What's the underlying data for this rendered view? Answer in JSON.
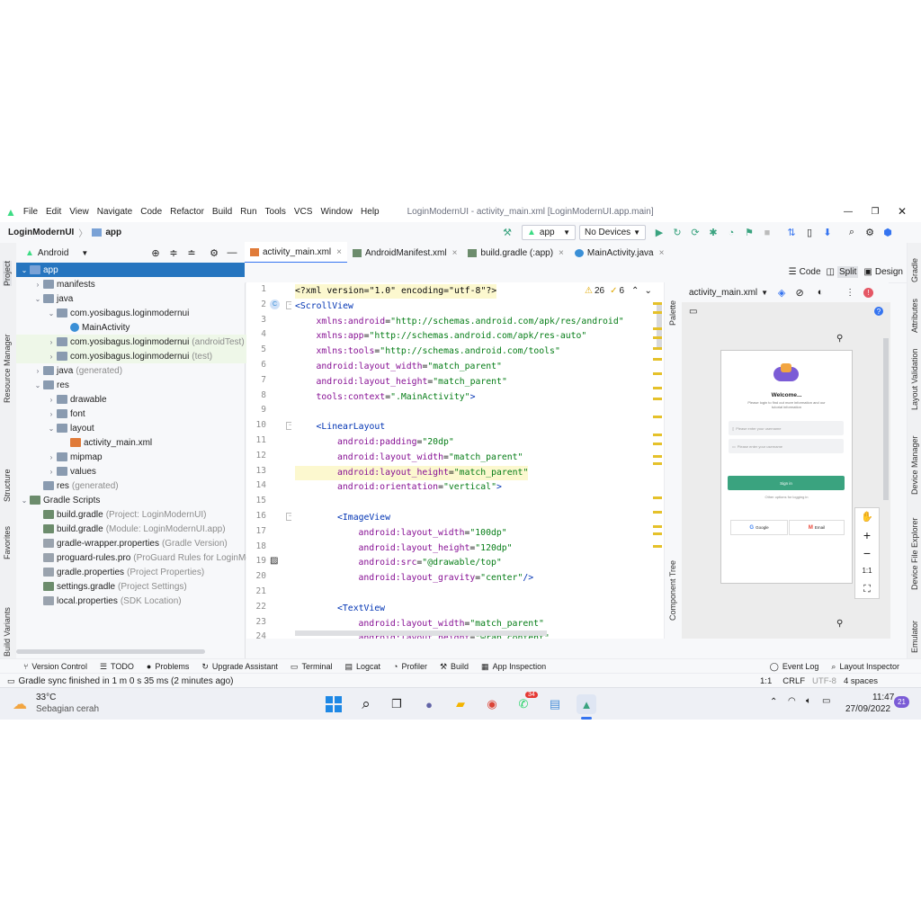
{
  "window": {
    "title": "LoginModernUI - activity_main.xml [LoginModernUI.app.main]"
  },
  "menu": [
    "File",
    "Edit",
    "View",
    "Navigate",
    "Code",
    "Refactor",
    "Build",
    "Run",
    "Tools",
    "VCS",
    "Window",
    "Help"
  ],
  "breadcrumb": {
    "project": "LoginModernUI",
    "module": "app"
  },
  "toolbar": {
    "run_config": "app",
    "device": "No Devices"
  },
  "left_strip": [
    "Project",
    "Resource Manager",
    "Structure",
    "Favorites",
    "Build Variants"
  ],
  "right_strip": [
    "Gradle",
    "Attributes",
    "Layout Validation",
    "Device Manager",
    "Device File Explorer",
    "Emulator"
  ],
  "project_panel": {
    "view": "Android",
    "tree": [
      {
        "label": "app",
        "hint": "",
        "level": 0,
        "open": true,
        "kind": "module",
        "selected": true
      },
      {
        "label": "manifests",
        "hint": "",
        "level": 1,
        "open": false,
        "kind": "folder"
      },
      {
        "label": "java",
        "hint": "",
        "level": 1,
        "open": true,
        "kind": "folder"
      },
      {
        "label": "com.yosibagus.loginmodernui",
        "hint": "",
        "level": 2,
        "open": true,
        "kind": "package"
      },
      {
        "label": "MainActivity",
        "hint": "",
        "level": 3,
        "leaf": true,
        "kind": "class"
      },
      {
        "label": "com.yosibagus.loginmodernui",
        "hint": "(androidTest)",
        "level": 2,
        "open": false,
        "kind": "package",
        "green": true
      },
      {
        "label": "com.yosibagus.loginmodernui",
        "hint": "(test)",
        "level": 2,
        "open": false,
        "kind": "package",
        "green": true
      },
      {
        "label": "java",
        "hint": "(generated)",
        "level": 1,
        "open": false,
        "kind": "folder"
      },
      {
        "label": "res",
        "hint": "",
        "level": 1,
        "open": true,
        "kind": "folder"
      },
      {
        "label": "drawable",
        "hint": "",
        "level": 2,
        "open": false,
        "kind": "folder"
      },
      {
        "label": "font",
        "hint": "",
        "level": 2,
        "open": false,
        "kind": "folder"
      },
      {
        "label": "layout",
        "hint": "",
        "level": 2,
        "open": true,
        "kind": "folder"
      },
      {
        "label": "activity_main.xml",
        "hint": "",
        "level": 3,
        "leaf": true,
        "kind": "xml"
      },
      {
        "label": "mipmap",
        "hint": "",
        "level": 2,
        "open": false,
        "kind": "folder"
      },
      {
        "label": "values",
        "hint": "",
        "level": 2,
        "open": false,
        "kind": "folder"
      },
      {
        "label": "res",
        "hint": "(generated)",
        "level": 1,
        "leaf": true,
        "kind": "folder"
      },
      {
        "label": "Gradle Scripts",
        "hint": "",
        "level": 0,
        "open": true,
        "kind": "gradle"
      },
      {
        "label": "build.gradle",
        "hint": "(Project: LoginModernUI)",
        "level": 1,
        "leaf": true,
        "kind": "gradle"
      },
      {
        "label": "build.gradle",
        "hint": "(Module: LoginModernUI.app)",
        "level": 1,
        "leaf": true,
        "kind": "gradle"
      },
      {
        "label": "gradle-wrapper.properties",
        "hint": "(Gradle Version)",
        "level": 1,
        "leaf": true,
        "kind": "props"
      },
      {
        "label": "proguard-rules.pro",
        "hint": "(ProGuard Rules for LoginMo",
        "level": 1,
        "leaf": true,
        "kind": "props"
      },
      {
        "label": "gradle.properties",
        "hint": "(Project Properties)",
        "level": 1,
        "leaf": true,
        "kind": "props"
      },
      {
        "label": "settings.gradle",
        "hint": "(Project Settings)",
        "level": 1,
        "leaf": true,
        "kind": "gradle"
      },
      {
        "label": "local.properties",
        "hint": "(SDK Location)",
        "level": 1,
        "leaf": true,
        "kind": "props"
      }
    ]
  },
  "editor_tabs": [
    {
      "label": "activity_main.xml",
      "active": true,
      "icon": "xml-icon"
    },
    {
      "label": "AndroidManifest.xml",
      "active": false,
      "icon": "manifest-icon"
    },
    {
      "label": "build.gradle (:app)",
      "active": false,
      "icon": "gradle-icon"
    },
    {
      "label": "MainActivity.java",
      "active": false,
      "icon": "class-icon"
    }
  ],
  "view_modes": [
    "Code",
    "Split",
    "Design"
  ],
  "inspections": {
    "warnings": "26",
    "weak": "6"
  },
  "code_lines": [
    {
      "n": "1",
      "indent": 0,
      "parts": [
        [
          "plain",
          "<?xml version=\"1.0\" encoding=\"utf-8\"?>"
        ]
      ],
      "hl": true
    },
    {
      "n": "2",
      "indent": 0,
      "parts": [
        [
          "tag",
          "<ScrollView"
        ]
      ]
    },
    {
      "n": "3",
      "indent": 1,
      "parts": [
        [
          "attr",
          "xmlns:android"
        ],
        [
          "plain",
          "="
        ],
        [
          "val",
          "\"http://schemas.android.com/apk/res/android\""
        ]
      ]
    },
    {
      "n": "4",
      "indent": 1,
      "parts": [
        [
          "attr",
          "xmlns:app"
        ],
        [
          "plain",
          "="
        ],
        [
          "val",
          "\"http://schemas.android.com/apk/res-auto\""
        ]
      ]
    },
    {
      "n": "5",
      "indent": 1,
      "parts": [
        [
          "attr",
          "xmlns:tools"
        ],
        [
          "plain",
          "="
        ],
        [
          "val",
          "\"http://schemas.android.com/tools\""
        ]
      ]
    },
    {
      "n": "6",
      "indent": 1,
      "parts": [
        [
          "attr",
          "android:layout_width"
        ],
        [
          "plain",
          "="
        ],
        [
          "val",
          "\"match_parent\""
        ]
      ]
    },
    {
      "n": "7",
      "indent": 1,
      "parts": [
        [
          "attr",
          "android:layout_height"
        ],
        [
          "plain",
          "="
        ],
        [
          "val",
          "\"match_parent\""
        ]
      ]
    },
    {
      "n": "8",
      "indent": 1,
      "parts": [
        [
          "attr",
          "tools:context"
        ],
        [
          "plain",
          "="
        ],
        [
          "val",
          "\".MainActivity\""
        ],
        [
          "tag",
          ">"
        ]
      ]
    },
    {
      "n": "9",
      "indent": 0,
      "parts": []
    },
    {
      "n": "10",
      "indent": 1,
      "parts": [
        [
          "tag",
          "<LinearLayout"
        ]
      ]
    },
    {
      "n": "11",
      "indent": 2,
      "parts": [
        [
          "attr",
          "android:padding"
        ],
        [
          "plain",
          "="
        ],
        [
          "val",
          "\"20dp\""
        ]
      ]
    },
    {
      "n": "12",
      "indent": 2,
      "parts": [
        [
          "attr",
          "android:layout_width"
        ],
        [
          "plain",
          "="
        ],
        [
          "val",
          "\"match_parent\""
        ]
      ]
    },
    {
      "n": "13",
      "indent": 2,
      "parts": [
        [
          "attr",
          "android:layout_height"
        ],
        [
          "plain",
          "="
        ],
        [
          "val",
          "\"match_parent\""
        ]
      ],
      "hl": true
    },
    {
      "n": "14",
      "indent": 2,
      "parts": [
        [
          "attr",
          "android:orientation"
        ],
        [
          "plain",
          "="
        ],
        [
          "val",
          "\"vertical\""
        ],
        [
          "tag",
          ">"
        ]
      ]
    },
    {
      "n": "15",
      "indent": 0,
      "parts": []
    },
    {
      "n": "16",
      "indent": 2,
      "parts": [
        [
          "tag",
          "<ImageView"
        ]
      ]
    },
    {
      "n": "17",
      "indent": 3,
      "parts": [
        [
          "attr",
          "android:layout_width"
        ],
        [
          "plain",
          "="
        ],
        [
          "val",
          "\"100dp\""
        ]
      ]
    },
    {
      "n": "18",
      "indent": 3,
      "parts": [
        [
          "attr",
          "android:layout_height"
        ],
        [
          "plain",
          "="
        ],
        [
          "val",
          "\"120dp\""
        ]
      ]
    },
    {
      "n": "19",
      "indent": 3,
      "parts": [
        [
          "attr",
          "android:src"
        ],
        [
          "plain",
          "="
        ],
        [
          "val",
          "\"@drawable/top\""
        ]
      ]
    },
    {
      "n": "20",
      "indent": 3,
      "parts": [
        [
          "attr",
          "android:layout_gravity"
        ],
        [
          "plain",
          "="
        ],
        [
          "val",
          "\"center\""
        ],
        [
          "tag",
          "/>"
        ]
      ]
    },
    {
      "n": "21",
      "indent": 0,
      "parts": []
    },
    {
      "n": "22",
      "indent": 2,
      "parts": [
        [
          "tag",
          "<TextView"
        ]
      ]
    },
    {
      "n": "23",
      "indent": 3,
      "parts": [
        [
          "attr",
          "android:layout_width"
        ],
        [
          "plain",
          "="
        ],
        [
          "val",
          "\"match_parent\""
        ]
      ]
    },
    {
      "n": "24",
      "indent": 3,
      "parts": [
        [
          "attr",
          "android:layout_height"
        ],
        [
          "plain",
          "="
        ],
        [
          "val",
          "\"wrap_content\""
        ]
      ]
    }
  ],
  "preview": {
    "file": "activity_main.xml",
    "palette": "Palette",
    "component_tree": "Component Tree",
    "zoom_reset": "1:1",
    "app": {
      "welcome": "Welcome...",
      "subtitle": "Please login to find out more information and our tutorial information",
      "username_hint": "Please enter your username",
      "password_hint": "Please enter your username",
      "signin": "Sign in",
      "other": "Other options for logging in",
      "google": "Google",
      "email": "Email"
    }
  },
  "toolwindows": [
    "Version Control",
    "TODO",
    "Problems",
    "Upgrade Assistant",
    "Terminal",
    "Logcat",
    "Profiler",
    "Build",
    "App Inspection"
  ],
  "toolwindows_right": [
    "Event Log",
    "Layout Inspector"
  ],
  "status": {
    "message": "Gradle sync finished in 1 m 0 s 35 ms (2 minutes ago)",
    "position": "1:1",
    "line_sep": "CRLF",
    "encoding": "UTF-8",
    "indent": "4 spaces"
  },
  "taskbar": {
    "temp": "33°C",
    "weather": "Sebagian cerah",
    "whatsapp_badge": "34",
    "time": "11:47",
    "date": "27/09/2022",
    "notif_count": "21"
  },
  "colors": {
    "accent": "#3574f0",
    "selection": "#2675bf",
    "signin": "#3aa37f"
  }
}
